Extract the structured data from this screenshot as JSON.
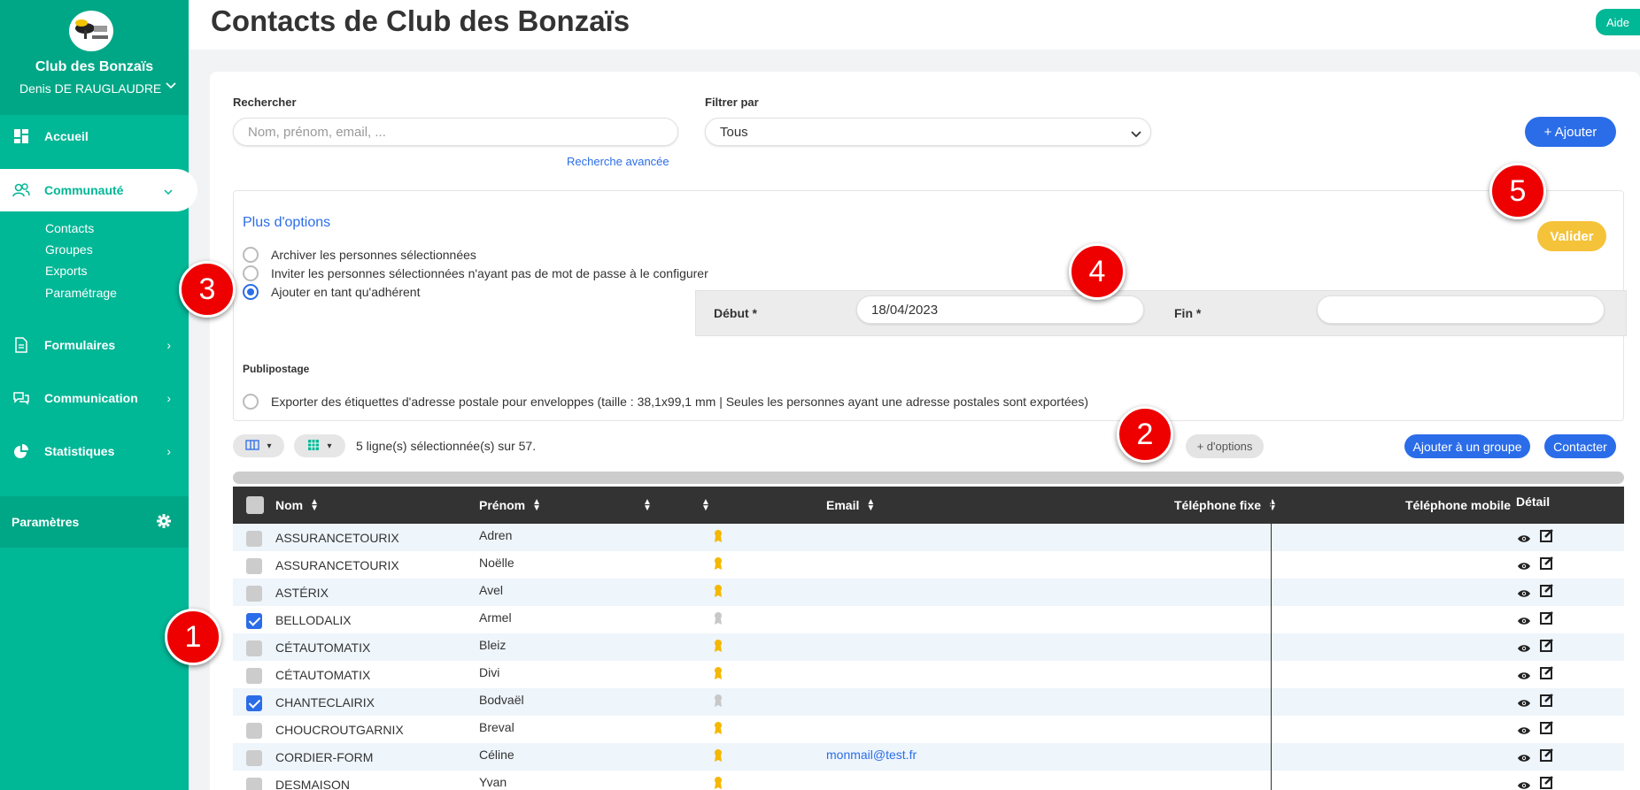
{
  "sidebar": {
    "club_name": "Club des Bonzaïs",
    "user_name": "Denis DE RAUGLAUDRE",
    "nav": [
      {
        "label": "Accueil",
        "icon": "dashboard-icon"
      },
      {
        "label": "Communauté",
        "icon": "community-icon",
        "active": true
      },
      {
        "label": "Formulaires",
        "icon": "document-icon"
      },
      {
        "label": "Communication",
        "icon": "chat-icon"
      },
      {
        "label": "Statistiques",
        "icon": "pie-chart-icon"
      }
    ],
    "subnav": [
      "Contacts",
      "Groupes",
      "Exports",
      "Paramétrage"
    ],
    "params_label": "Paramètres"
  },
  "header": {
    "title": "Contacts de Club des Bonzaïs",
    "help": "Aide"
  },
  "search": {
    "label": "Rechercher",
    "placeholder": "Nom, prénom, email, ...",
    "advanced": "Recherche avancée"
  },
  "filter": {
    "label": "Filtrer par",
    "value": "Tous"
  },
  "add_button": "+ Ajouter",
  "options": {
    "title": "Plus d'options",
    "archive": "Archiver les personnes sélectionnées",
    "invite": "Inviter les personnes sélectionnées n'ayant pas de mot de passe à le configurer",
    "member": "Ajouter en tant qu'adhérent",
    "validate": "Valider",
    "start_label": "Début *",
    "start_value": "18/04/2023",
    "end_label": "Fin *",
    "end_value": "",
    "mailing_title": "Publipostage",
    "mailing_option": "Exporter des étiquettes d'adresse postale pour enveloppes (taille : 38,1x99,1 mm | Seules les personnes ayant une adresse postales sont exportées)"
  },
  "toolbar": {
    "selection": "5 ligne(s) sélectionnée(s) sur 57.",
    "more_options": "+ d'options",
    "add_group": "Ajouter à un groupe",
    "contact": "Contacter"
  },
  "badges": [
    "1",
    "2",
    "3",
    "4",
    "5"
  ],
  "table": {
    "headers": {
      "nom": "Nom",
      "prenom": "Prénom",
      "email": "Email",
      "tel_fixe": "Téléphone fixe",
      "tel_mobile": "Téléphone mobile",
      "detail": "Détail"
    },
    "rows": [
      {
        "nom": "ASSURANCETOURIX",
        "prenom": "Adren",
        "email": "",
        "checked": false,
        "member": true
      },
      {
        "nom": "ASSURANCETOURIX",
        "prenom": "Noëlle",
        "email": "",
        "checked": false,
        "member": true
      },
      {
        "nom": "ASTÉRIX",
        "prenom": "Avel",
        "email": "",
        "checked": false,
        "member": true
      },
      {
        "nom": "BELLODALIX",
        "prenom": "Armel",
        "email": "",
        "checked": true,
        "member": false
      },
      {
        "nom": "CÉTAUTOMATIX",
        "prenom": "Bleiz",
        "email": "",
        "checked": false,
        "member": true
      },
      {
        "nom": "CÉTAUTOMATIX",
        "prenom": "Divi",
        "email": "",
        "checked": false,
        "member": true
      },
      {
        "nom": "CHANTECLAIRIX",
        "prenom": "Bodvaël",
        "email": "",
        "checked": true,
        "member": false
      },
      {
        "nom": "CHOUCROUTGARNIX",
        "prenom": "Breval",
        "email": "",
        "checked": false,
        "member": true
      },
      {
        "nom": "CORDIER-FORM",
        "prenom": "Céline",
        "email": "monmail@test.fr",
        "checked": false,
        "member": true
      },
      {
        "nom": "DESMAISON",
        "prenom": "Yvan",
        "email": "",
        "checked": false,
        "member": true
      }
    ]
  },
  "colors": {
    "brand": "#00b796",
    "accent": "#2b6de8",
    "warning": "#f5c33a",
    "badge": "#e00000"
  }
}
